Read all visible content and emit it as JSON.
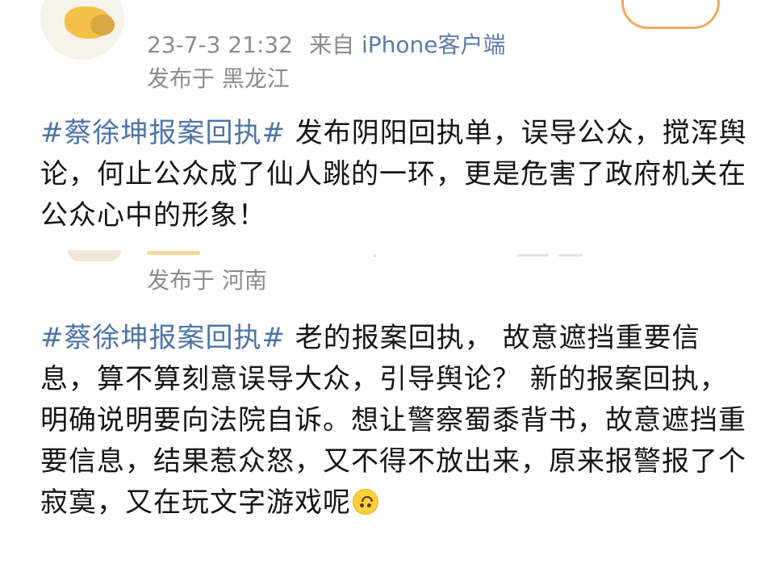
{
  "post1": {
    "avatar_icon": "user-avatar-icon",
    "timestamp": "23-7-3 21:32",
    "source_prefix": "来自",
    "source_client": "iPhone客户端",
    "location": "发布于 黑龙江",
    "hashtag": "#蔡徐坤报案回执#",
    "body": "发布阴阳回执单，误导公众，搅浑舆论，何止公众成了仙人跳的一环，更是危害了政府机关在公众心中的形象！"
  },
  "post2": {
    "avatar_icon": "user-avatar-icon",
    "location": "发布于 河南",
    "hashtag": "#蔡徐坤报案回执#",
    "body": "老的报案回执， 故意遮挡重要信息，算不算刻意误导大众，引导舆论？ 新的报案回执，明确说明要向法院自诉。想让警察蜀黍背书，故意遮挡重要信息，结果惹众怒，又不得不放出来，原来报警报了个寂寞，又在玩文字游戏呢",
    "emoji_icon": "upside-down-face-emoji-icon"
  },
  "colors": {
    "hashtag": "#4e74a6",
    "meta": "#8c8c8c",
    "follow_border": "#f0a95e"
  }
}
